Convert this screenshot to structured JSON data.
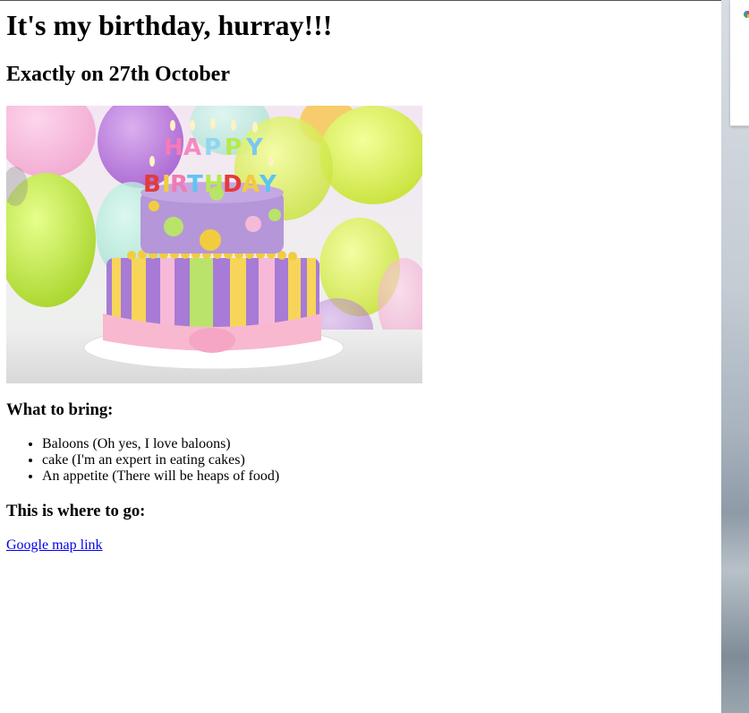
{
  "page": {
    "title": "It's my birthday, hurray!!!",
    "subtitle": "Exactly on 27th October",
    "image_alt": "Birthday cake with HAPPY BIRTHDAY candles",
    "bring_heading": "What to bring:",
    "bring_items": [
      "Baloons (Oh yes, I love baloons)",
      "cake (I'm an expert in eating cakes)",
      "An appetite (There will be heaps of food)"
    ],
    "go_heading": "This is where to go:",
    "map_link": "Google map link"
  },
  "colors": {
    "link": "#0000ee",
    "text": "#000000",
    "background": "#ffffff"
  }
}
